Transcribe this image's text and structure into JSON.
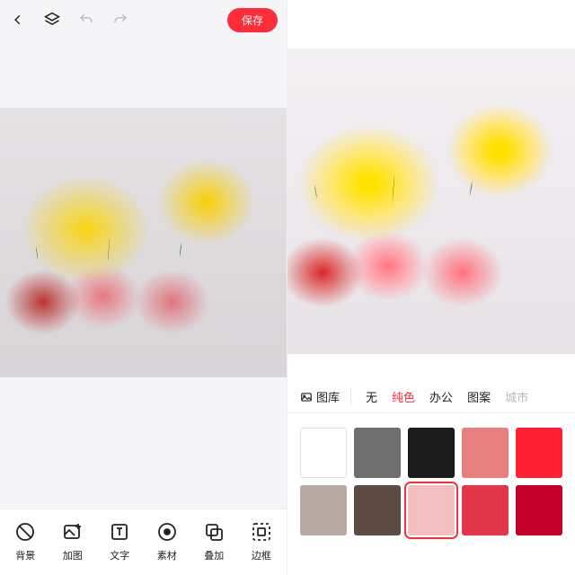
{
  "left": {
    "save_label": "保存",
    "tools": [
      {
        "icon": "bg",
        "label": "背景"
      },
      {
        "icon": "addimg",
        "label": "加图"
      },
      {
        "icon": "text",
        "label": "文字"
      },
      {
        "icon": "asset",
        "label": "素材"
      },
      {
        "icon": "overlay",
        "label": "叠加"
      },
      {
        "icon": "frame",
        "label": "边框"
      }
    ]
  },
  "right": {
    "library_label": "图库",
    "categories": [
      {
        "key": "none",
        "label": "无",
        "active": false
      },
      {
        "key": "solid",
        "label": "纯色",
        "active": true
      },
      {
        "key": "office",
        "label": "办公",
        "active": false
      },
      {
        "key": "pattern",
        "label": "图案",
        "active": false
      },
      {
        "key": "city",
        "label": "城市",
        "active": false
      }
    ],
    "swatches": [
      {
        "hex": "#ffffff",
        "selected": false,
        "white": true
      },
      {
        "hex": "#6f6f6f",
        "selected": false
      },
      {
        "hex": "#1a1a1a",
        "selected": false
      },
      {
        "hex": "#e98080",
        "selected": false
      },
      {
        "hex": "#ff1f35",
        "selected": false
      },
      {
        "hex": "#b8aaa3",
        "selected": false
      },
      {
        "hex": "#5d4a42",
        "selected": false
      },
      {
        "hex": "#f3bfc0",
        "selected": true
      },
      {
        "hex": "#e2374b",
        "selected": false
      },
      {
        "hex": "#c3002a",
        "selected": false
      }
    ]
  }
}
